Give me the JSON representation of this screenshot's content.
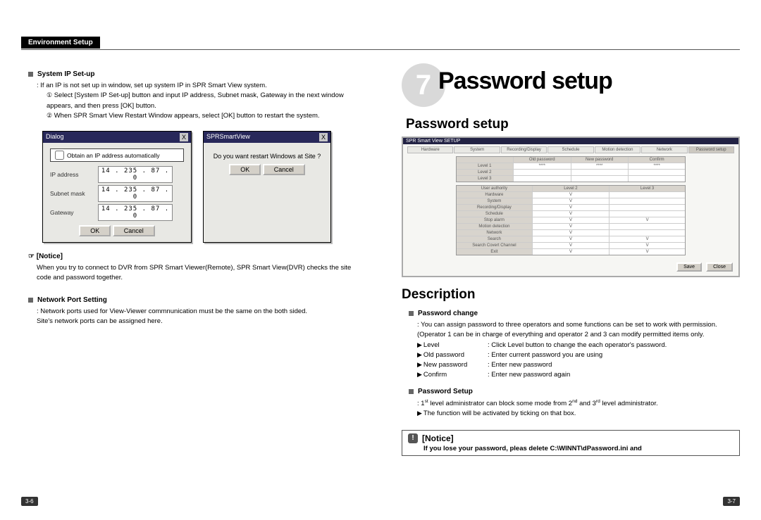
{
  "header": {
    "label": "Environment Setup"
  },
  "left": {
    "sysip": {
      "heading": "System IP Set-up",
      "intro": ": If an IP is not set up in window, set up system IP in SPR Smart View system.",
      "step1": "Select [System IP Set-up] button and input IP address, Subnet mask, Gateway in the next window appears, and then press [OK] button.",
      "step2": "When SPR Smart View Restart Window appears, select [OK] button to restart the system."
    },
    "dlg1": {
      "title": "Dialog",
      "close": "X",
      "chk": "Obtain an IP address automatically",
      "lbl_ip": "IP address",
      "val_ip": "14 . 235 . 87 .   0",
      "lbl_sn": "Subnet mask",
      "val_sn": "14 . 235 . 87 .   0",
      "lbl_gw": "Gateway",
      "val_gw": "14 . 235 . 87 .   0",
      "ok": "OK",
      "cancel": "Cancel"
    },
    "dlg2": {
      "title": "SPRSmartView",
      "close": "X",
      "msg": "Do you want restart Windows at Site ?",
      "ok": "OK",
      "cancel": "Cancel"
    },
    "notice": {
      "heading": "☞ [Notice]",
      "body": "When you try to connect to DVR from SPR Smart Viewer(Remote), SPR Smart View(DVR) checks the site code and password together."
    },
    "netport": {
      "heading": "Network Port Setting",
      "l1": ": Network ports used for View-Viewer commnunication must be the same on the both sided.",
      "l2": "Site's network ports can be assigned here."
    }
  },
  "right": {
    "chapter": {
      "num": "7",
      "title": "Password setup",
      "subtitle": "Password setup"
    },
    "scr": {
      "win": "SPR Smart View SETUP",
      "tabs": [
        "Hardware",
        "System",
        "Recording/Display",
        "Schedule",
        "Motion detection",
        "Network",
        "Password setup"
      ],
      "g1_heads": [
        "",
        "Old password",
        "New password",
        "Confirm"
      ],
      "g1_rows": [
        [
          "Level 1",
          "****",
          "****",
          "****"
        ],
        [
          "Level 2",
          "",
          "",
          ""
        ],
        [
          "Level 3",
          "",
          "",
          ""
        ]
      ],
      "g2_heads": [
        "User authority",
        "Level 2",
        "Level 3"
      ],
      "g2_rows": [
        [
          "Hardware",
          "V",
          ""
        ],
        [
          "System",
          "V",
          ""
        ],
        [
          "Recording/Display",
          "V",
          ""
        ],
        [
          "Schedule",
          "V",
          ""
        ],
        [
          "Stop alarm",
          "V",
          "V"
        ],
        [
          "Motion detection",
          "V",
          ""
        ],
        [
          "Network",
          "V",
          ""
        ],
        [
          "Search",
          "V",
          "V"
        ],
        [
          "Search Covert Channel",
          "V",
          "V"
        ],
        [
          "Exit",
          "V",
          "V"
        ]
      ],
      "save": "Save",
      "close": "Close"
    },
    "desc": {
      "title": "Description",
      "pwc_heading": "Password change",
      "pwc_body": ": You can assign password to three operators and some functions can be set to work with permission. (Operator 1 can be in charge of everything and operator 2 and 3 can modify permitted items only.",
      "kv": [
        {
          "k": "Level",
          "v": ": Click Level button to change the each operator's password."
        },
        {
          "k": "Old password",
          "v": ": Enter current password you are using"
        },
        {
          "k": "New password",
          "v": ": Enter new password"
        },
        {
          "k": "Confirm",
          "v": ": Enter new password again"
        }
      ],
      "pws_heading": "Password Setup",
      "pws_l1": ": 1st level administrator can block some mode from 2nd and 3rd level administrator.",
      "pws_l2": "The function will be activated by ticking on that box."
    },
    "nbox": {
      "heading": "[Notice]",
      "body": "If you lose your password, pleas delete C:\\WINNT\\dPassword.ini and"
    }
  },
  "footer": {
    "left_page": "3-6",
    "right_page": "3-7"
  }
}
